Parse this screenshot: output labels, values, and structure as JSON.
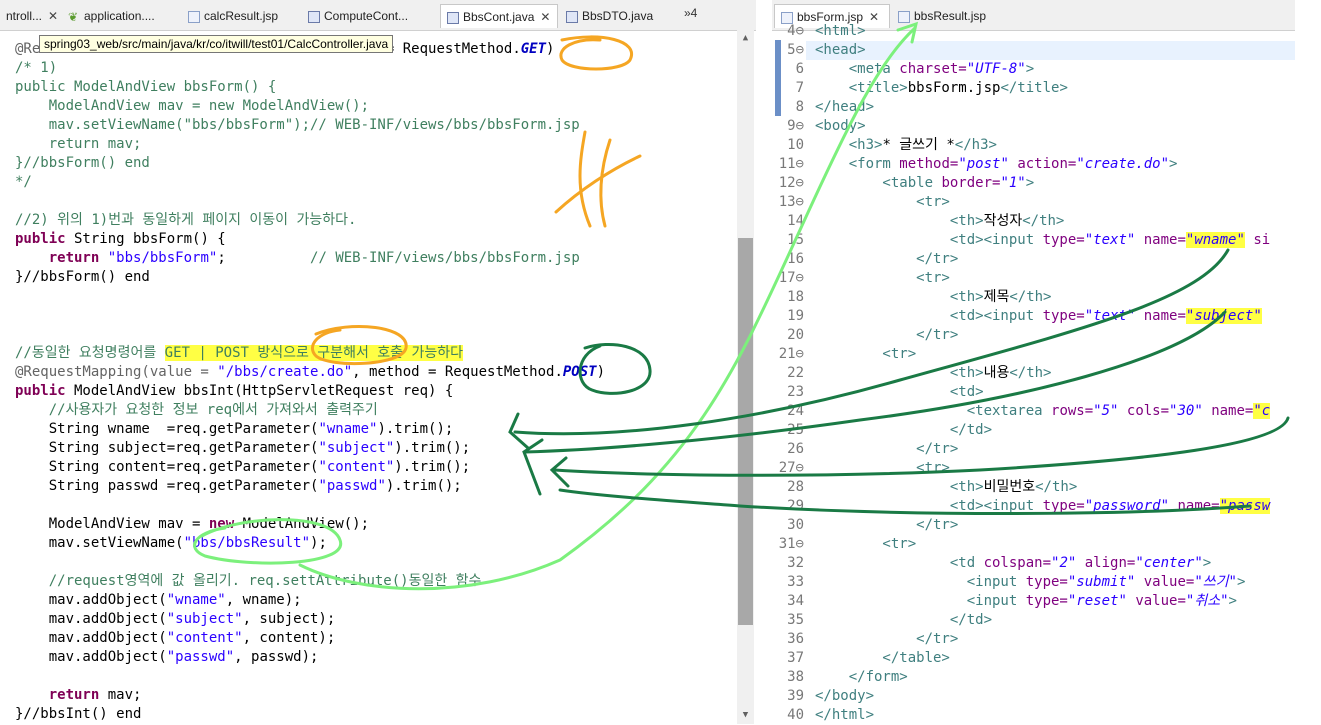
{
  "left_tabs": [
    {
      "label": "ntroll...",
      "closable": true
    },
    {
      "label": "application....",
      "icon": "leaf-icon"
    },
    {
      "label": "calcResult.jsp",
      "icon": "jsp-file-icon"
    },
    {
      "label": "ComputeCont...",
      "icon": "java-file-icon"
    },
    {
      "label": "BbsCont.java",
      "icon": "java-file-icon",
      "active": true,
      "closable": true
    },
    {
      "label": "BbsDTO.java",
      "icon": "java-file-icon"
    }
  ],
  "left_overflow": "»4",
  "right_tabs": [
    {
      "label": "bbsForm.jsp",
      "active": true,
      "closable": true
    },
    {
      "label": "bbsResult.jsp"
    }
  ],
  "tooltip": "spring03_web/src/main/java/kr/co/itwill/test01/CalcController.java",
  "java_lines": {
    "l1": "@Re",
    "l1b": "ethod = RequestMethod.",
    "l1c": "GET",
    "l1d": ")",
    "l2": "/* 1)",
    "l3": "public ModelAndView bbsForm() {",
    "l4": "    ModelAndView mav = new ModelAndView();",
    "l5": "    mav.setViewName(\"bbs/bbsForm\");// WEB-INF/views/bbs/bbsForm.jsp",
    "l6": "    return mav;",
    "l7": "}//bbsForm() end",
    "l8": "*/",
    "l10": "//2) 위의 1)번과 동일하게 페이지 이동이 가능하다.",
    "l11a": "public",
    "l11b": " String bbsForm() {",
    "l12a": "    return",
    "l12b": " ",
    "l12c": "\"bbs/bbsForm\"",
    "l12d": ";",
    "l12e": "          // WEB-INF/views/bbs/bbsForm.jsp",
    "l13": "}//bbsForm() end",
    "l17a": "//동일한 요청명령어를 ",
    "l17b": "GET | POST 방식으로 구분해서 호출 가능하다",
    "l18a": "@RequestMapping(value = ",
    "l18b": "\"/bbs/create.do\"",
    "l18c": ", method = RequestMethod.",
    "l18d": "POST",
    "l18e": ")",
    "l19a": "public",
    "l19b": " ModelAndView bbsInt(HttpServletRequest req) {",
    "l20": "    //사용자가 요청한 정보 req에서 가져와서 출력주기",
    "l21a": "    String wname  =req.getParameter(",
    "l21b": "\"wname\"",
    "l21c": ").trim();",
    "l22a": "    String subject=req.getParameter(",
    "l22b": "\"subject\"",
    "l22c": ").trim();",
    "l23a": "    String content=req.getParameter(",
    "l23b": "\"content\"",
    "l23c": ").trim();",
    "l24a": "    String passwd =req.getParameter(",
    "l24b": "\"passwd\"",
    "l24c": ").trim();",
    "l26a": "    ModelAndView mav = ",
    "l26b": "new",
    "l26c": " ModelAndView();",
    "l27a": "    mav.setViewName(",
    "l27b": "\"bbs/bbsResult\"",
    "l27c": ");",
    "l29": "    //request영역에 값 올리기. req.settAttribute()동일한 함수",
    "l30a": "    mav.addObject(",
    "l30b": "\"wname\"",
    "l30c": ", wname);",
    "l31a": "    mav.addObject(",
    "l31b": "\"subject\"",
    "l31c": ", subject);",
    "l32a": "    mav.addObject(",
    "l32b": "\"content\"",
    "l32c": ", content);",
    "l33a": "    mav.addObject(",
    "l33b": "\"passwd\"",
    "l33c": ", passwd);",
    "l35a": "    return",
    "l35b": " mav;",
    "l36": "}//bbsInt() end"
  },
  "line_numbers": "4⊖\n5⊖\n6\n7\n8\n9⊖\n10\n11⊖\n12⊖\n13⊖\n14\n15\n16\n17⊖\n18\n19\n20\n21⊖\n22\n23\n24\n25\n26\n27⊖\n28\n29\n30\n31⊖\n32\n33\n34\n35\n36\n37\n38\n39\n40",
  "jsp_lines": {
    "r4": "<html>",
    "r5": "<head>",
    "r6a": "    <meta ",
    "r6b": "charset=",
    "r6c": "\"UTF-8\"",
    "r6d": ">",
    "r7a": "    <title>",
    "r7b": "bbsForm.jsp",
    "r7c": "</title>",
    "r8": "</head>",
    "r9": "<body>",
    "r10a": "    <h3>",
    "r10b": "* 글쓰기 *",
    "r10c": "</h3>",
    "r11a": "    <form ",
    "r11b": "method=",
    "r11c": "\"post\"",
    "r11d": " action=",
    "r11e": "\"create.do\"",
    "r11f": ">",
    "r12a": "        <table ",
    "r12b": "border=",
    "r12c": "\"1\"",
    "r12d": ">",
    "r13": "            <tr>",
    "r14a": "                <th>",
    "r14b": "작성자",
    "r14c": "</th>",
    "r15a": "                <td><input ",
    "r15b": "type=",
    "r15c": "\"text\"",
    "r15d": " name=",
    "r15e": "\"wname\"",
    "r15f": " si",
    "r16": "            </tr>",
    "r17": "            <tr>",
    "r18a": "                <th>",
    "r18b": "제목",
    "r18c": "</th>",
    "r19a": "                <td><input ",
    "r19b": "type=",
    "r19c": "\"text\"",
    "r19d": " name=",
    "r19e": "\"subject\"",
    "r20": "            </tr>",
    "r21": "        <tr>",
    "r22a": "                <th>",
    "r22b": "내용",
    "r22c": "</th>",
    "r23": "                <td>",
    "r24a": "                  <textarea ",
    "r24b": "rows=",
    "r24c": "\"5\"",
    "r24d": " cols=",
    "r24e": "\"30\"",
    "r24f": " name=",
    "r24g": "\"c",
    "r25": "                </td>",
    "r26": "            </tr>",
    "r27": "            <tr>",
    "r28a": "                <th>",
    "r28b": "비밀번호",
    "r28c": "</th>",
    "r29a": "                <td><input ",
    "r29b": "type=",
    "r29c": "\"password\"",
    "r29d": " name=",
    "r29e": "\"passw",
    "r30": "            </tr>",
    "r31": "        <tr>",
    "r32a": "                <td ",
    "r32b": "colspan=",
    "r32c": "\"2\"",
    "r32d": " align=",
    "r32e": "\"center\"",
    "r32f": ">",
    "r33a": "                  <input ",
    "r33b": "type=",
    "r33c": "\"submit\"",
    "r33d": " value=",
    "r33e": "\"쓰기\"",
    "r33f": ">",
    "r34a": "                  <input ",
    "r34b": "type=",
    "r34c": "\"reset\"",
    "r34d": " value=",
    "r34e": "\"취소\"",
    "r34f": ">",
    "r35": "                </td>",
    "r36": "            </tr>",
    "r37": "        </table>",
    "r38": "    </form>",
    "r39": "</body>",
    "r40": "</html>"
  },
  "colors": {
    "annotation_orange": "#f5a623",
    "annotation_light_green": "#7cf07c",
    "annotation_dark_green": "#1a7a45",
    "highlight_yellow": "#ffff44"
  }
}
